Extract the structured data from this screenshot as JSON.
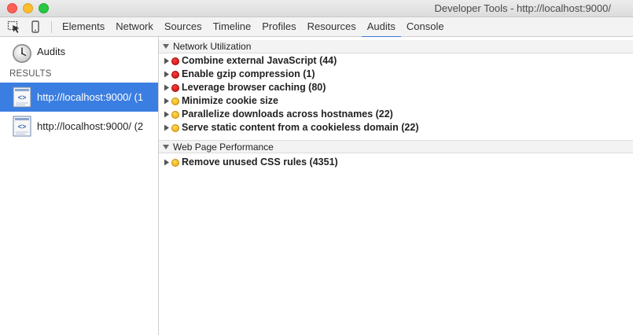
{
  "window": {
    "title": "Developer Tools - http://localhost:9000/"
  },
  "toolbar": {
    "icons": [
      "inspect-element-icon",
      "device-mode-icon"
    ],
    "tabs": [
      {
        "label": "Elements",
        "active": false
      },
      {
        "label": "Network",
        "active": false
      },
      {
        "label": "Sources",
        "active": false
      },
      {
        "label": "Timeline",
        "active": false
      },
      {
        "label": "Profiles",
        "active": false
      },
      {
        "label": "Resources",
        "active": false
      },
      {
        "label": "Audits",
        "active": true
      },
      {
        "label": "Console",
        "active": false
      }
    ],
    "active_color": "#3879d9"
  },
  "sidebar": {
    "audits_label": "Audits",
    "results_label": "RESULTS",
    "results": [
      {
        "label": "http://localhost:9000/ (1",
        "selected": true
      },
      {
        "label": "http://localhost:9000/ (2",
        "selected": false
      }
    ],
    "selected_color": "#3b7ee1"
  },
  "main": {
    "categories": [
      {
        "title": "Network Utilization",
        "rules": [
          {
            "text": "Combine external JavaScript (44)",
            "severity": "red"
          },
          {
            "text": "Enable gzip compression (1)",
            "severity": "red"
          },
          {
            "text": "Leverage browser caching (80)",
            "severity": "red"
          },
          {
            "text": "Minimize cookie size",
            "severity": "yellow"
          },
          {
            "text": "Parallelize downloads across hostnames (22)",
            "severity": "yellow"
          },
          {
            "text": "Serve static content from a cookieless domain (22)",
            "severity": "yellow"
          }
        ]
      },
      {
        "title": "Web Page Performance",
        "rules": [
          {
            "text": "Remove unused CSS rules (4351)",
            "severity": "yellow"
          }
        ]
      }
    ]
  }
}
